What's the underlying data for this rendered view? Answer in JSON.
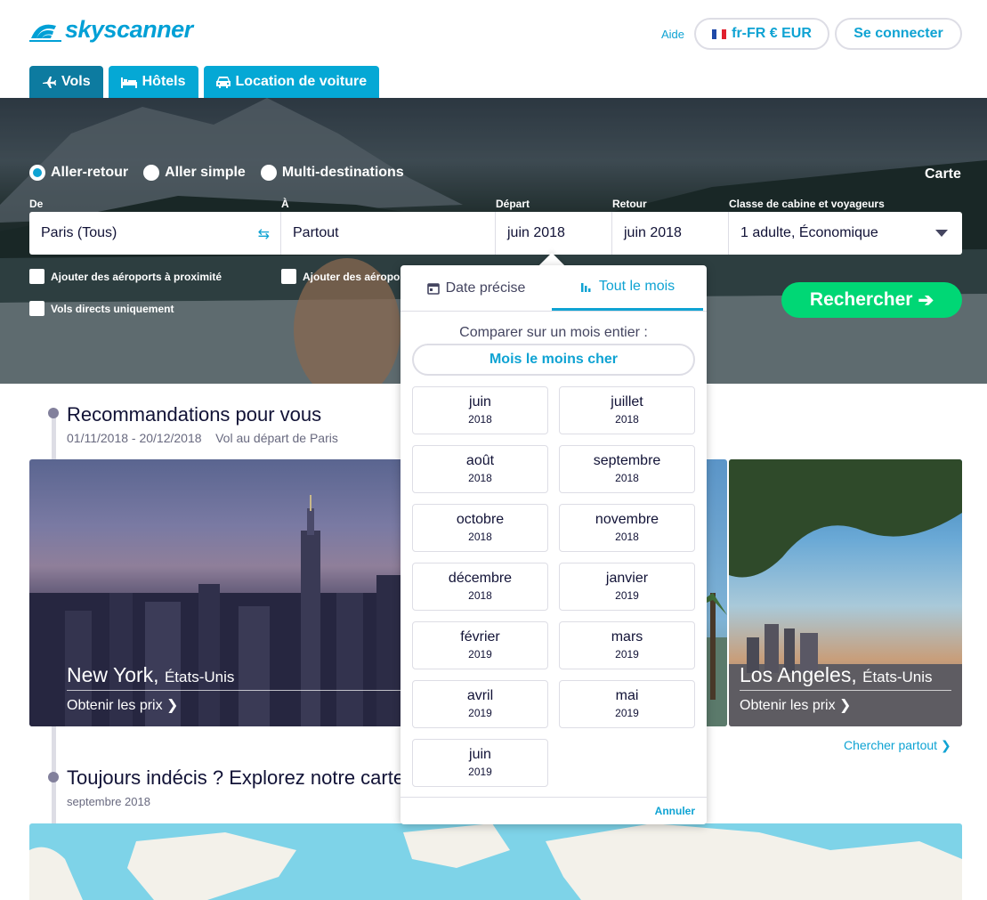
{
  "header": {
    "logo": "skyscanner",
    "help": "Aide",
    "locale": "fr-FR € EUR",
    "login": "Se connecter"
  },
  "tabs": [
    {
      "label": "Vols",
      "icon": "plane-icon",
      "active": true
    },
    {
      "label": "Hôtels",
      "icon": "bed-icon",
      "active": false
    },
    {
      "label": "Location de voiture",
      "icon": "car-icon",
      "active": false
    }
  ],
  "trip_types": [
    {
      "label": "Aller-retour",
      "selected": true
    },
    {
      "label": "Aller simple",
      "selected": false
    },
    {
      "label": "Multi-destinations",
      "selected": false
    }
  ],
  "map_link": "Carte",
  "search": {
    "from_label": "De",
    "from_value": "Paris (Tous)",
    "to_label": "À",
    "to_value": "Partout",
    "depart_label": "Départ",
    "depart_value": "juin 2018",
    "return_label": "Retour",
    "return_value": "juin 2018",
    "cabin_label": "Classe de cabine et voyageurs",
    "cabin_value": "1 adulte, Économique",
    "nearby_from": "Ajouter des aéroports à proximité",
    "nearby_to": "Ajouter des aéropor",
    "direct_only": "Vols directs uniquement",
    "submit": "Rechercher"
  },
  "recommendations": {
    "title": "Recommandations pour vous",
    "dates": "01/11/2018 - 20/12/2018",
    "subtitle": "Vol au départ de Paris",
    "cards": [
      {
        "city": "New York,",
        "country": "États-Unis",
        "price": "Obtenir les prix"
      },
      {
        "city": "Los Angeles,",
        "country": "États-Unis",
        "price": "Obtenir les prix"
      }
    ],
    "more": "Chercher partout"
  },
  "explore": {
    "title": "Toujours indécis ? Explorez notre carte",
    "subtitle": "septembre 2018"
  },
  "popover": {
    "tab_exact": "Date précise",
    "tab_month": "Tout le mois",
    "compare": "Comparer sur un mois entier :",
    "cheapest": "Mois le moins cher",
    "months": [
      {
        "m": "juin",
        "y": "2018"
      },
      {
        "m": "juillet",
        "y": "2018"
      },
      {
        "m": "août",
        "y": "2018"
      },
      {
        "m": "septembre",
        "y": "2018"
      },
      {
        "m": "octobre",
        "y": "2018"
      },
      {
        "m": "novembre",
        "y": "2018"
      },
      {
        "m": "décembre",
        "y": "2018"
      },
      {
        "m": "janvier",
        "y": "2019"
      },
      {
        "m": "février",
        "y": "2019"
      },
      {
        "m": "mars",
        "y": "2019"
      },
      {
        "m": "avril",
        "y": "2019"
      },
      {
        "m": "mai",
        "y": "2019"
      },
      {
        "m": "juin",
        "y": "2019"
      }
    ],
    "cancel": "Annuler"
  },
  "colors": {
    "brand": "#0fa3d3",
    "tab": "#05a8d5",
    "tab_active": "#0d7ba0",
    "cta": "#00d775"
  }
}
